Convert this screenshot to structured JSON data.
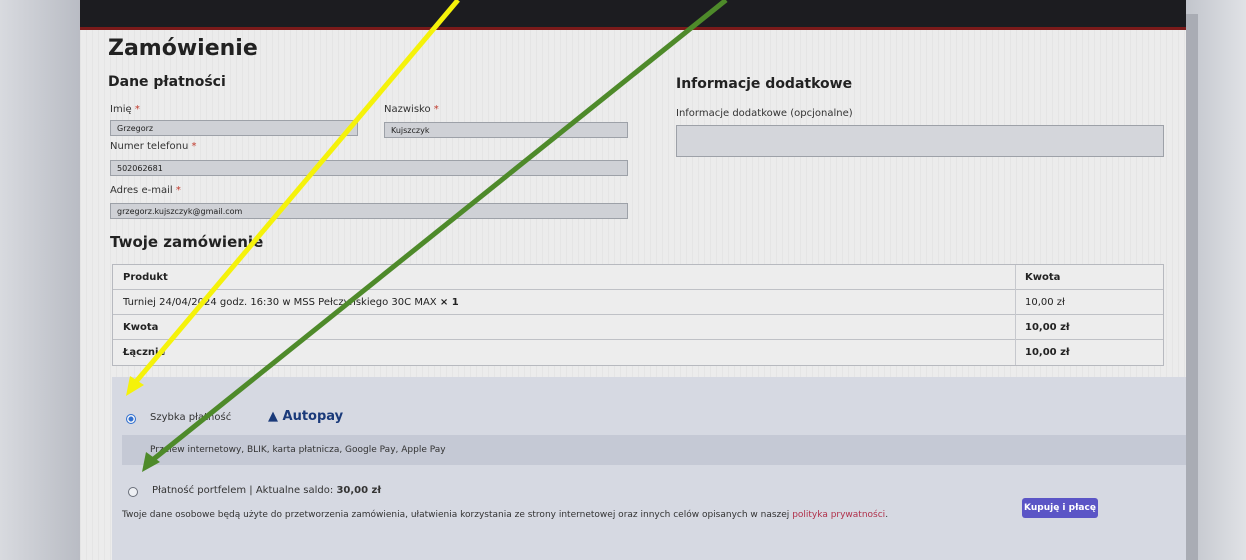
{
  "order": {
    "title": "Zamówienie",
    "billing_title": "Dane płatności",
    "additional_title": "Informacje dodatkowe",
    "first_name": {
      "label": "Imię",
      "value": "Grzegorz"
    },
    "last_name": {
      "label": "Nazwisko",
      "value": "Kujszczyk"
    },
    "phone": {
      "label": "Numer telefonu",
      "value": "502062681"
    },
    "email": {
      "label": "Adres e-mail",
      "value": "grzegorz.kujszczyk@gmail.com"
    },
    "notes": {
      "label": "Informacje dodatkowe (opcjonalne)",
      "value": ""
    },
    "required_mark": "*"
  },
  "summary": {
    "title": "Twoje zamówienie",
    "header": {
      "product": "Produkt",
      "amount": "Kwota"
    },
    "item": {
      "product": "Turniej 24/04/2024 godz. 16:30 w MSS Pełczyńskiego 30C MAX",
      "qty": "× 1",
      "amount": "10,00 zł"
    },
    "subtotal": {
      "label": "Kwota",
      "amount": "10,00 zł"
    },
    "total": {
      "label": "Łącznie",
      "amount": "10,00 zł"
    }
  },
  "payment": {
    "fast_payment": {
      "label": "Szybka płatność",
      "brand": "Autopay",
      "selected": true
    },
    "methods_text": "Przelew internetowy, BLIK, karta płatnicza, Google Pay, Apple Pay",
    "wallet": {
      "label": "Płatność portfelem | Aktualne saldo:",
      "balance": "30,00 zł",
      "selected": false
    },
    "consent_text": "Twoje dane osobowe będą użyte do przetworzenia zamówienia, ułatwienia korzystania ze strony internetowej oraz innych celów opisanych w naszej",
    "privacy_link": "polityka prywatności",
    "buy_button": "Kupuję i płacę"
  },
  "colors": {
    "annotation_yellow": "#f5f20a",
    "annotation_green": "#4e8a2a",
    "button": "#5b55c6"
  }
}
